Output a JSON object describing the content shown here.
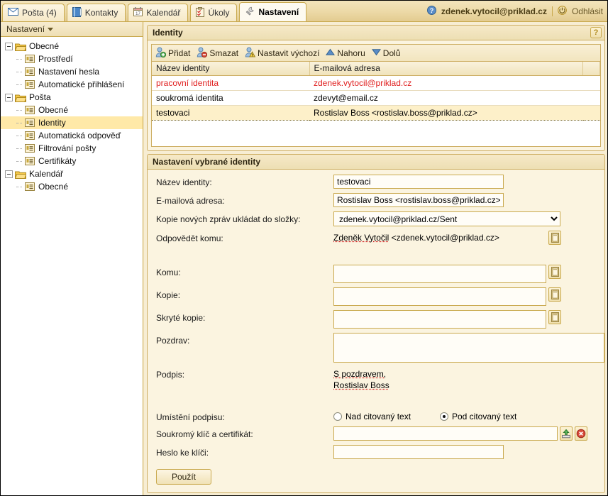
{
  "header": {
    "tabs": [
      {
        "label": "Pošta (4)",
        "icon": "envelope-icon",
        "active": false
      },
      {
        "label": "Kontakty",
        "icon": "address-book-icon",
        "active": false
      },
      {
        "label": "Kalendář",
        "icon": "calendar-icon",
        "active": false
      },
      {
        "label": "Úkoly",
        "icon": "tasks-clipboard-icon",
        "active": false
      },
      {
        "label": "Nastavení",
        "icon": "wrench-icon",
        "active": true
      }
    ],
    "user_email": "zdenek.vytocil@priklad.cz",
    "logout_label": "Odhlásit"
  },
  "sidebar": {
    "title": "Nastavení",
    "groups": [
      {
        "label": "Obecné",
        "children": [
          {
            "label": "Prostředí",
            "selected": false
          },
          {
            "label": "Nastavení hesla",
            "selected": false
          },
          {
            "label": "Automatické přihlášení",
            "selected": false
          }
        ]
      },
      {
        "label": "Pošta",
        "children": [
          {
            "label": "Obecné",
            "selected": false
          },
          {
            "label": "Identity",
            "selected": true
          },
          {
            "label": "Automatická odpověď",
            "selected": false
          },
          {
            "label": "Filtrování pošty",
            "selected": false
          },
          {
            "label": "Certifikáty",
            "selected": false
          }
        ]
      },
      {
        "label": "Kalendář",
        "children": [
          {
            "label": "Obecné",
            "selected": false
          }
        ]
      }
    ]
  },
  "identity_panel": {
    "title": "Identity",
    "help_label": "?",
    "toolbar": [
      {
        "label": "Přidat",
        "icon": "user-add-icon"
      },
      {
        "label": "Smazat",
        "icon": "user-delete-icon"
      },
      {
        "label": "Nastavit výchozí",
        "icon": "user-default-icon"
      },
      {
        "label": "Nahoru",
        "icon": "arrow-up-icon"
      },
      {
        "label": "Dolů",
        "icon": "arrow-down-icon"
      }
    ],
    "columns": [
      "Název identity",
      "E-mailová adresa"
    ],
    "rows": [
      {
        "name": "pracovní identita",
        "email": "zdenek.vytocil@priklad.cz",
        "is_default": true,
        "selected": false
      },
      {
        "name": "soukromá identita",
        "email": "zdevyt@email.cz",
        "is_default": false,
        "selected": false
      },
      {
        "name": "testovaci",
        "email": "Rostislav Boss <rostislav.boss@priklad.cz>",
        "is_default": false,
        "selected": true
      }
    ]
  },
  "settings_panel": {
    "title": "Nastavení vybrané identity",
    "fields": {
      "name_label": "Název identity:",
      "name_value": "testovaci",
      "email_label": "E-mailová adresa:",
      "email_value": "Rostislav Boss <rostislav.boss@priklad.cz>",
      "sentfolder_label": "Kopie nových zpráv ukládat do složky:",
      "sentfolder_value": "zdenek.vytocil@priklad.cz/Sent",
      "replyto_label": "Odpovědět komu:",
      "replyto_value_spell": "Zdeněk Vytočil",
      "replyto_value_rest": " <zdenek.vytocil@priklad.cz>",
      "to_label": "Komu:",
      "to_value": "",
      "cc_label": "Kopie:",
      "cc_value": "",
      "bcc_label": "Skryté kopie:",
      "bcc_value": "",
      "greeting_label": "Pozdrav:",
      "greeting_value": "",
      "signature_label": "Podpis:",
      "signature_line1_spell": "S pozdravem,",
      "signature_line2_spell": "Rostislav Boss",
      "sigpos_label": "Umístění podpisu:",
      "sigpos_above": "Nad citovaný text",
      "sigpos_below": "Pod citovaný text",
      "sigpos_selected": "below",
      "cert_label": "Soukromý klíč a certifikát:",
      "cert_value": "",
      "certpass_label": "Heslo ke klíči:",
      "certpass_value": "",
      "apply_label": "Použít"
    },
    "icons": {
      "addressbook": "address-book-icon",
      "upload": "upload-icon",
      "delete": "delete-icon"
    }
  },
  "colors": {
    "accent": "#c9a94e",
    "panel_bg": "#fbf4e0",
    "selected_row": "#fdf0c9",
    "default_identity": "#e02020",
    "tree_selected": "#ffe9a8"
  }
}
